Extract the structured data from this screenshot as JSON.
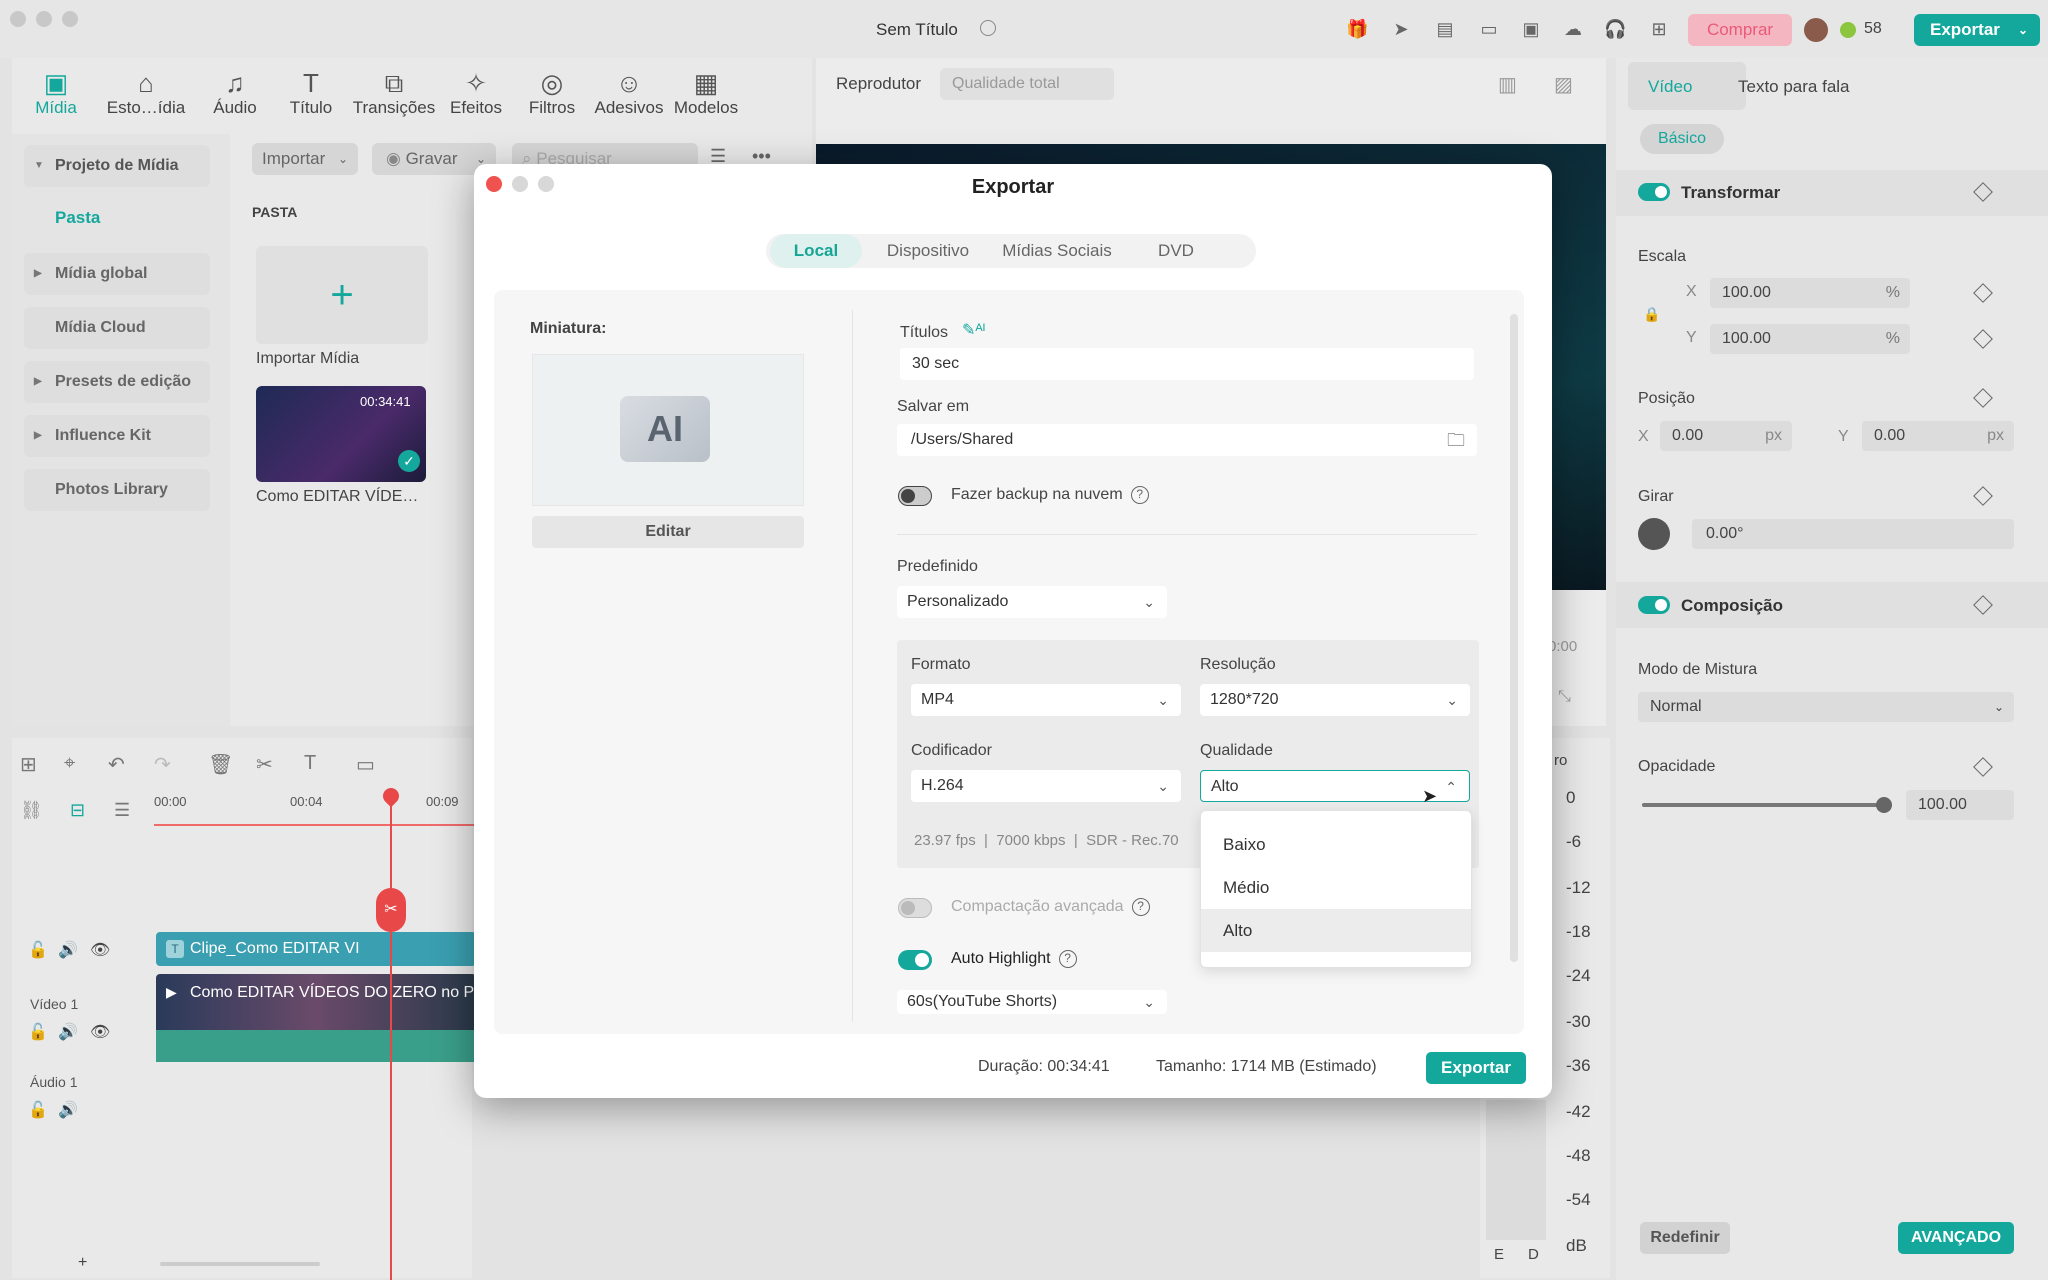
{
  "window": {
    "title": "Sem Título"
  },
  "topbar": {
    "comprar": "Comprar",
    "credits": "58",
    "exportar": "Exportar"
  },
  "toolbar": {
    "items": [
      "Mídia",
      "Esto…ídia",
      "Áudio",
      "Título",
      "Transições",
      "Efeitos",
      "Filtros",
      "Adesivos",
      "Modelos"
    ]
  },
  "sidebar": {
    "items": [
      "Projeto de Mídia",
      "Pasta",
      "Mídia global",
      "Mídia Cloud",
      "Presets de edição",
      "Influence Kit",
      "Photos Library"
    ]
  },
  "media": {
    "import_btn": "Importar",
    "record_btn": "Gravar",
    "search_placeholder": "Pesquisar",
    "folder_label": "PASTA",
    "import_media": "Importar Mídia",
    "clip_duration": "00:34:41",
    "clip_name": "Como EDITAR VÍDE…"
  },
  "player": {
    "title": "Reprodutor",
    "quality": "Qualidade total",
    "time": "0:00"
  },
  "timeline": {
    "ruler": [
      "00:00",
      "00:04",
      "00:09"
    ],
    "title_clip": "Clipe_Como EDITAR VI",
    "video_clip": "Como EDITAR VÍDEOS DO ZERO no P",
    "video_track": "Vídeo 1",
    "audio_track": "Áudio 1"
  },
  "meter": {
    "values": [
      "0",
      "-6",
      "-12",
      "-18",
      "-24",
      "-30",
      "-36",
      "-42",
      "-48",
      "-54",
      "dB"
    ],
    "labels": [
      "E",
      "D"
    ],
    "partial": "ro"
  },
  "right_panel": {
    "tabs": [
      "Vídeo",
      "Texto para fala"
    ],
    "basic": "Básico",
    "transform": "Transformar",
    "scale": "Escala",
    "scale_x": "100.00",
    "scale_y": "100.00",
    "pct": "%",
    "position": "Posição",
    "pos_x": "0.00",
    "pos_y": "0.00",
    "px": "px",
    "rotate": "Girar",
    "rotate_val": "0.00°",
    "composition": "Composição",
    "blend_mode": "Modo de Mistura",
    "blend_val": "Normal",
    "opacity": "Opacidade",
    "opacity_val": "100.00",
    "opacity_level": 1.0,
    "reset": "Redefinir",
    "advanced": "AVANÇADO"
  },
  "export_dialog": {
    "title": "Exportar",
    "tabs": [
      "Local",
      "Dispositivo",
      "Mídias Sociais",
      "DVD"
    ],
    "thumb_label": "Miniatura:",
    "edit_btn": "Editar",
    "titles_label": "Títulos",
    "titles_value": "30 sec",
    "save_label": "Salvar em",
    "save_path": "/Users/Shared",
    "backup_label": "Fazer backup na nuvem",
    "preset_label": "Predefinido",
    "preset_value": "Personalizado",
    "format_label": "Formato",
    "format_value": "MP4",
    "resolution_label": "Resolução",
    "resolution_value": "1280*720",
    "codec_label": "Codificador",
    "codec_value": "H.264",
    "quality_label": "Qualidade",
    "quality_value": "Alto",
    "fps": "23.97 fps",
    "kbps": "7000 kbps",
    "sdr": "SDR - Rec.70",
    "quality_options": [
      "Baixo",
      "Médio",
      "Alto"
    ],
    "advanced_compress": "Compactação avançada",
    "auto_highlight": "Auto Highlight",
    "highlight_value": "60s(YouTube Shorts)",
    "duration": "Duração: 00:34:41",
    "size": "Tamanho: 1714 MB (Estimado)",
    "export_btn": "Exportar"
  },
  "colors": {
    "accent": "#14a89c",
    "buy": "#ea5a78",
    "close": "#f0524f"
  }
}
